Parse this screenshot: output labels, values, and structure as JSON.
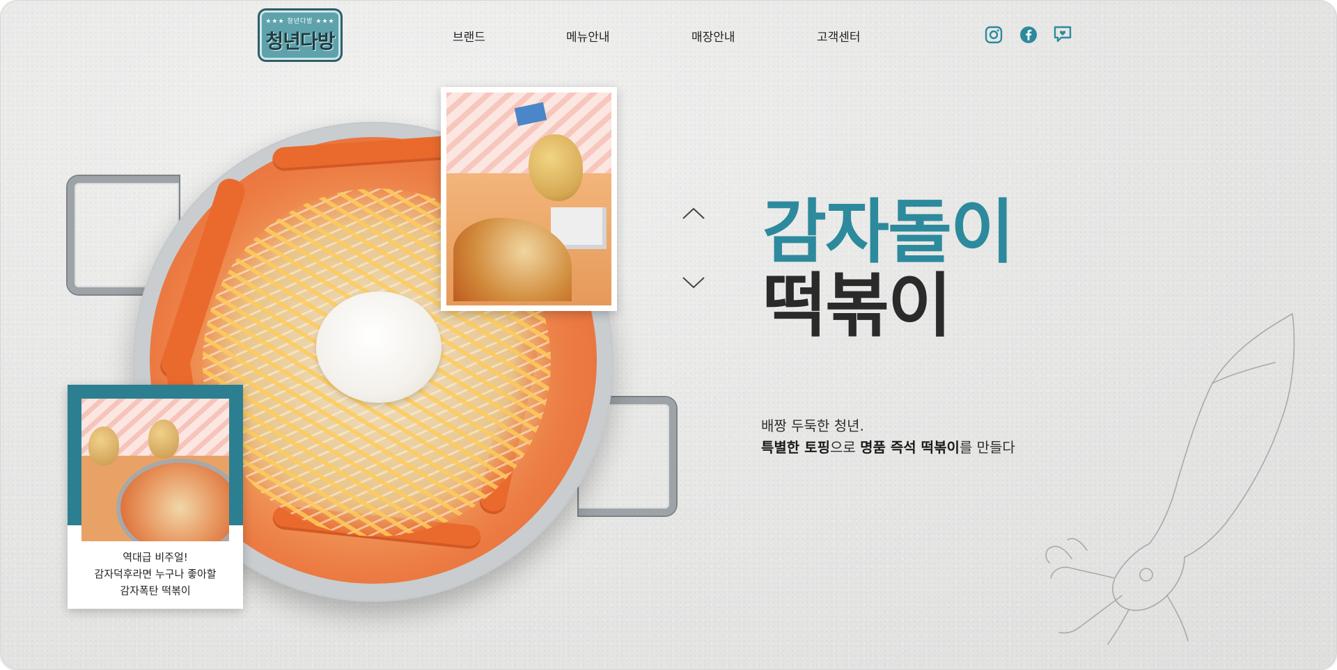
{
  "brand": {
    "logo_small": "★★★ 청년다방 ★★★",
    "logo_main": "청년다방"
  },
  "nav": {
    "items": [
      {
        "label": "브랜드"
      },
      {
        "label": "메뉴안내"
      },
      {
        "label": "매장안내"
      },
      {
        "label": "고객센터"
      }
    ]
  },
  "social": {
    "accent": "#2c8a9c",
    "icons": [
      "instagram-icon",
      "facebook-icon",
      "chat-heart-icon"
    ]
  },
  "hero": {
    "title_line1": "감자돌이",
    "title_line2": "떡볶이",
    "title_color_1": "#2c8a9c",
    "title_color_2": "#2a2a2a",
    "desc_line1": "배짱 두둑한 청년.",
    "desc_line2_bold1": "특별한 토핑",
    "desc_line2_mid": "으로 ",
    "desc_line2_bold2": "명품 즉석 떡볶이",
    "desc_line2_end": "를 만들다"
  },
  "card": {
    "caption_line1": "역대급 비주얼!",
    "caption_line2": "감자덕후라면 누구나 좋아할",
    "caption_line3": "감자폭탄 떡볶이",
    "frame_color": "#2c7f91"
  },
  "controls": {
    "up_icon": "chevron-up-icon",
    "down_icon": "chevron-down-icon"
  }
}
